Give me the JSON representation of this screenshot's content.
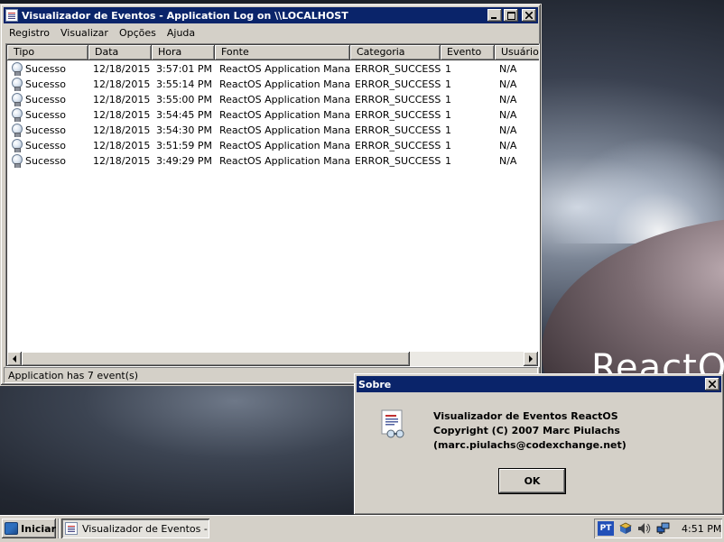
{
  "window": {
    "title": "Visualizador de Eventos - Application Log on \\\\LOCALHOST",
    "menu": [
      "Registro",
      "Visualizar",
      "Opções",
      "Ajuda"
    ],
    "columns": [
      "Tipo",
      "Data",
      "Hora",
      "Fonte",
      "Categoria",
      "Evento",
      "Usuário"
    ],
    "rows": [
      {
        "tipo": "Sucesso",
        "data": "12/18/2015",
        "hora": "3:57:01 PM",
        "fonte": "ReactOS Application Manager",
        "categoria": "ERROR_SUCCESS",
        "evento": "1",
        "usuario": "N/A"
      },
      {
        "tipo": "Sucesso",
        "data": "12/18/2015",
        "hora": "3:55:14 PM",
        "fonte": "ReactOS Application Manager",
        "categoria": "ERROR_SUCCESS",
        "evento": "1",
        "usuario": "N/A"
      },
      {
        "tipo": "Sucesso",
        "data": "12/18/2015",
        "hora": "3:55:00 PM",
        "fonte": "ReactOS Application Manager",
        "categoria": "ERROR_SUCCESS",
        "evento": "1",
        "usuario": "N/A"
      },
      {
        "tipo": "Sucesso",
        "data": "12/18/2015",
        "hora": "3:54:45 PM",
        "fonte": "ReactOS Application Manager",
        "categoria": "ERROR_SUCCESS",
        "evento": "1",
        "usuario": "N/A"
      },
      {
        "tipo": "Sucesso",
        "data": "12/18/2015",
        "hora": "3:54:30 PM",
        "fonte": "ReactOS Application Manager",
        "categoria": "ERROR_SUCCESS",
        "evento": "1",
        "usuario": "N/A"
      },
      {
        "tipo": "Sucesso",
        "data": "12/18/2015",
        "hora": "3:51:59 PM",
        "fonte": "ReactOS Application Manager",
        "categoria": "ERROR_SUCCESS",
        "evento": "1",
        "usuario": "N/A"
      },
      {
        "tipo": "Sucesso",
        "data": "12/18/2015",
        "hora": "3:49:29 PM",
        "fonte": "ReactOS Application Manager",
        "categoria": "ERROR_SUCCESS",
        "evento": "1",
        "usuario": "N/A"
      }
    ],
    "status": "Application has 7 event(s)",
    "type_icon": "lightbulb-icon"
  },
  "dialog": {
    "title": "Sobre",
    "lines": [
      "Visualizador de Eventos ReactOS",
      "Copyright (C) 2007 Marc Piulachs",
      "(marc.piulachs@codexchange.net)"
    ],
    "ok_label": "OK",
    "icon": "event-viewer-icon"
  },
  "taskbar": {
    "start_label": "Iniciar",
    "task_label": "Visualizador de Eventos - ...",
    "lang": "PT",
    "clock": "4:51 PM"
  },
  "wallpaper": {
    "text": "ReactOS"
  },
  "colors": {
    "titlebar": "#0a246a",
    "face": "#d4d0c8"
  }
}
